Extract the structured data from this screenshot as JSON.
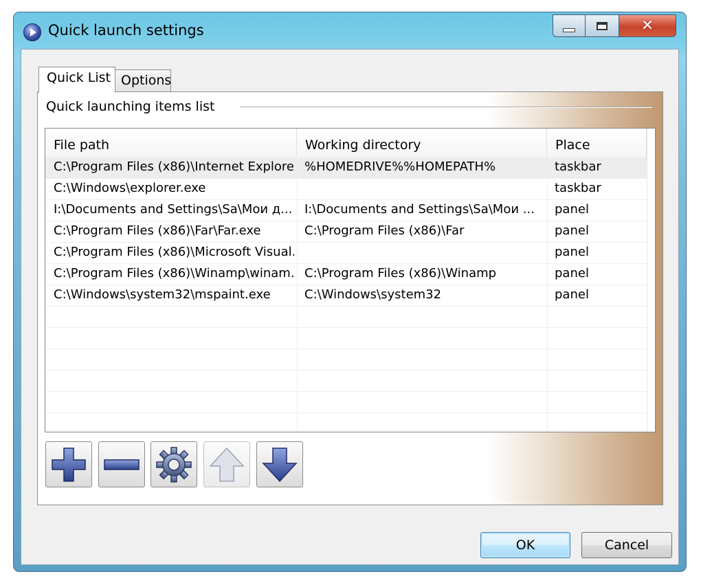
{
  "window": {
    "title": "Quick launch settings",
    "icon": "app-play-icon"
  },
  "tabs": [
    {
      "label": "Quick List",
      "active": true
    },
    {
      "label": "Options",
      "active": false
    }
  ],
  "section": {
    "label": "Quick launching items list"
  },
  "list": {
    "columns": [
      "File path",
      "Working directory",
      "Place"
    ],
    "rows": [
      {
        "file_path": "C:\\Program Files (x86)\\Internet Explore...",
        "working_directory": "%HOMEDRIVE%%HOMEPATH%",
        "place": "taskbar"
      },
      {
        "file_path": "C:\\Windows\\explorer.exe",
        "working_directory": "",
        "place": "taskbar"
      },
      {
        "file_path": "I:\\Documents and Settings\\Sa\\Мои д...",
        "working_directory": "I:\\Documents and Settings\\Sa\\Мои ...",
        "place": "panel"
      },
      {
        "file_path": "C:\\Program Files (x86)\\Far\\Far.exe",
        "working_directory": "C:\\Program Files (x86)\\Far",
        "place": "panel"
      },
      {
        "file_path": "C:\\Program Files (x86)\\Microsoft Visual...",
        "working_directory": "",
        "place": "panel"
      },
      {
        "file_path": "C:\\Program Files (x86)\\Winamp\\winam...",
        "working_directory": "C:\\Program Files (x86)\\Winamp",
        "place": "panel"
      },
      {
        "file_path": "C:\\Windows\\system32\\mspaint.exe",
        "working_directory": "C:\\Windows\\system32",
        "place": "panel"
      }
    ],
    "selected_row": 0
  },
  "toolbar": {
    "buttons": [
      {
        "icon": "plus-icon",
        "enabled": true
      },
      {
        "icon": "minus-icon",
        "enabled": true
      },
      {
        "icon": "gear-icon",
        "enabled": true
      },
      {
        "icon": "arrow-up-icon",
        "enabled": false
      },
      {
        "icon": "arrow-down-icon",
        "enabled": true
      }
    ]
  },
  "dialog": {
    "ok_label": "OK",
    "cancel_label": "Cancel"
  },
  "colors": {
    "accent": "#5ab4dc",
    "close": "#c8432c",
    "icon_blue": "#3b55a8"
  }
}
